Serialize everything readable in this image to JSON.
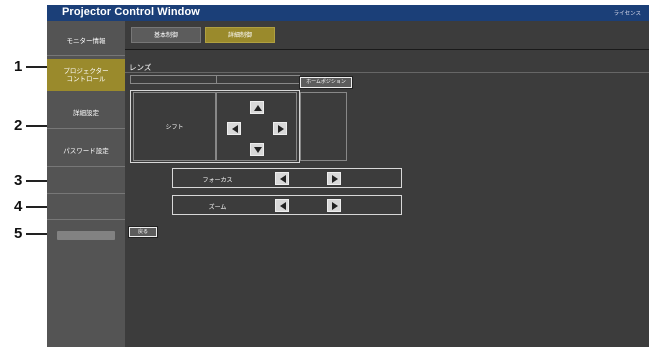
{
  "window": {
    "title": "Projector Control Window",
    "license_link": "ライセンス"
  },
  "sidebar": {
    "items": [
      {
        "label": "モニター情報"
      },
      {
        "label_line1": "プロジェクター",
        "label_line2": "コントロール"
      },
      {
        "label": "詳細設定"
      },
      {
        "label": "パスワード設定"
      }
    ]
  },
  "tabs": {
    "basic": "基本制御",
    "detail": "詳細制御"
  },
  "lens": {
    "section_label": "レンズ",
    "home_position_button": "ホームポジション",
    "shift_label": "シフト",
    "focus_label": "フォーカス",
    "zoom_label": "ズーム",
    "back_button": "戻る"
  },
  "callouts": [
    "1",
    "2",
    "3",
    "4",
    "5"
  ],
  "colors": {
    "title_bar": "#1b3f78",
    "active_accent": "#9a8a2c",
    "background": "#3c3c3c",
    "sidebar": "#545454"
  }
}
